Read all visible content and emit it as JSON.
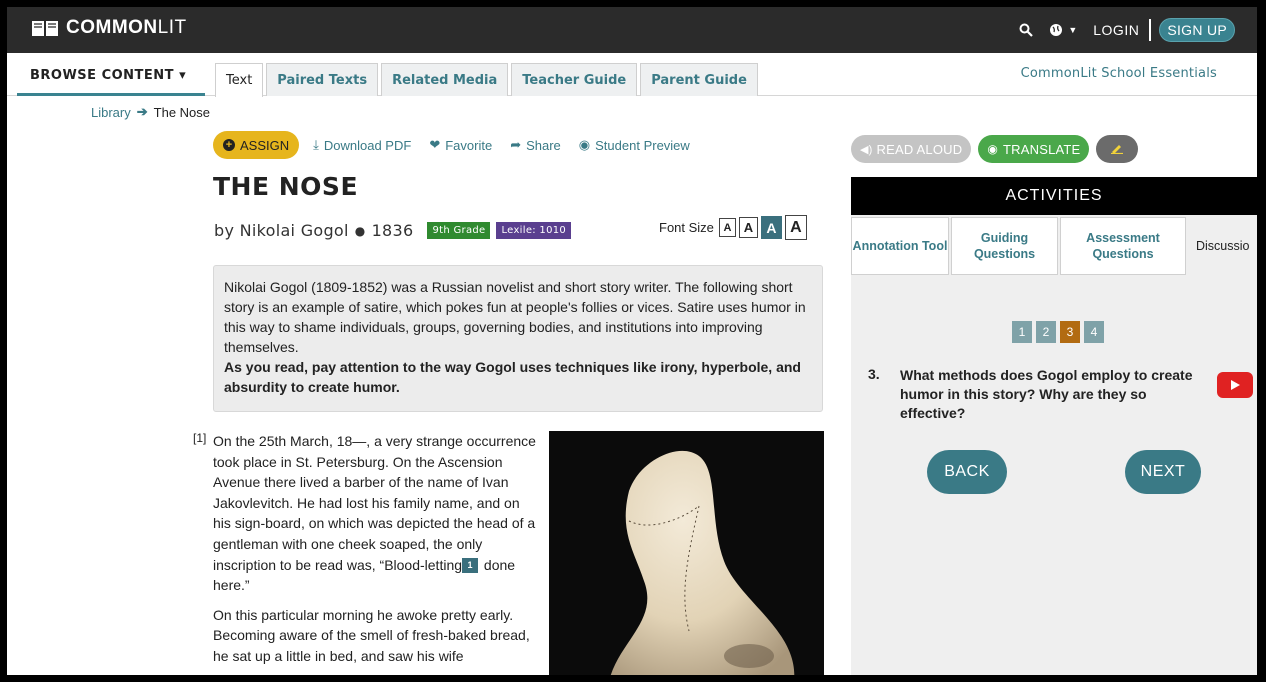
{
  "topnav": {
    "logo_bold": "COMMON",
    "logo_light": "LIT",
    "login": "LOGIN",
    "signup": "SIGN UP",
    "icons": [
      "search-icon",
      "globe-icon",
      "chevron-down-icon"
    ]
  },
  "subnav": {
    "browse": "BROWSE CONTENT ▾",
    "tabs": [
      {
        "label": "Text",
        "active": true
      },
      {
        "label": "Paired Texts",
        "active": false
      },
      {
        "label": "Related Media",
        "active": false
      },
      {
        "label": "Teacher Guide",
        "active": false
      },
      {
        "label": "Parent Guide",
        "active": false
      }
    ],
    "school_essentials": "CommonLit School Essentials"
  },
  "breadcrumb": {
    "library": "Library",
    "current": "The Nose"
  },
  "actions": {
    "assign": "ASSIGN",
    "download": "Download PDF",
    "favorite": "Favorite",
    "share": "Share",
    "preview": "Student Preview"
  },
  "text": {
    "title": "THE NOSE",
    "author": "by Nikolai Gogol",
    "year": "1836",
    "grade_badge": "9th Grade",
    "lexile_badge": "Lexile: 1010",
    "font_size_label": "Font Size",
    "font_sizes": [
      "A",
      "A",
      "A",
      "A"
    ],
    "selected_font_size_index": 2,
    "intro": "Nikolai Gogol (1809-1852) was a Russian novelist and short story writer. The following short story is an example of satire, which pokes fun at people's follies or vices. Satire uses humor in this way to shame individuals, groups, governing bodies, and institutions into improving themselves.",
    "intro_bold": "As you read, pay attention to the way Gogol uses techniques like irony, hyperbole, and absurdity to create humor.",
    "para_number": "[1]",
    "para1_before": "On the 25th March, 18—, a very strange occurrence took place in St. Petersburg. On the Ascension Avenue there lived a barber of the name of Ivan Jakovlevitch. He had lost his family name, and on his sign-board, on which was depicted the head of a gentleman with one cheek soaped, the only inscription to be read was, “Blood-letting",
    "footnote": "1",
    "para1_after": " done here.”",
    "para2": "On this particular morning he awoke pretty early. Becoming aware of the smell of fresh-baked bread, he sat up a little in bed, and saw his wife"
  },
  "right_panel": {
    "read_aloud": "READ ALOUD",
    "translate": "TRANSLATE",
    "activities": "ACTIVITIES",
    "tabs": [
      {
        "label": "Annotation Tool"
      },
      {
        "label": "Guiding Questions"
      },
      {
        "label": "Assessment Questions"
      },
      {
        "label": "Discussio"
      }
    ],
    "pages": [
      "1",
      "2",
      "3",
      "4"
    ],
    "current_page": "3",
    "question_number": "3.",
    "question": "What methods does Gogol employ to create humor in this story? Why are they so effective?",
    "back": "BACK",
    "next": "NEXT"
  },
  "colors": {
    "teal": "#3a7a86",
    "assign_yellow": "#e6b51d",
    "grade_green": "#2f8a2f",
    "lexile_purple": "#5a3f8f",
    "current_page_orange": "#b26b12"
  }
}
